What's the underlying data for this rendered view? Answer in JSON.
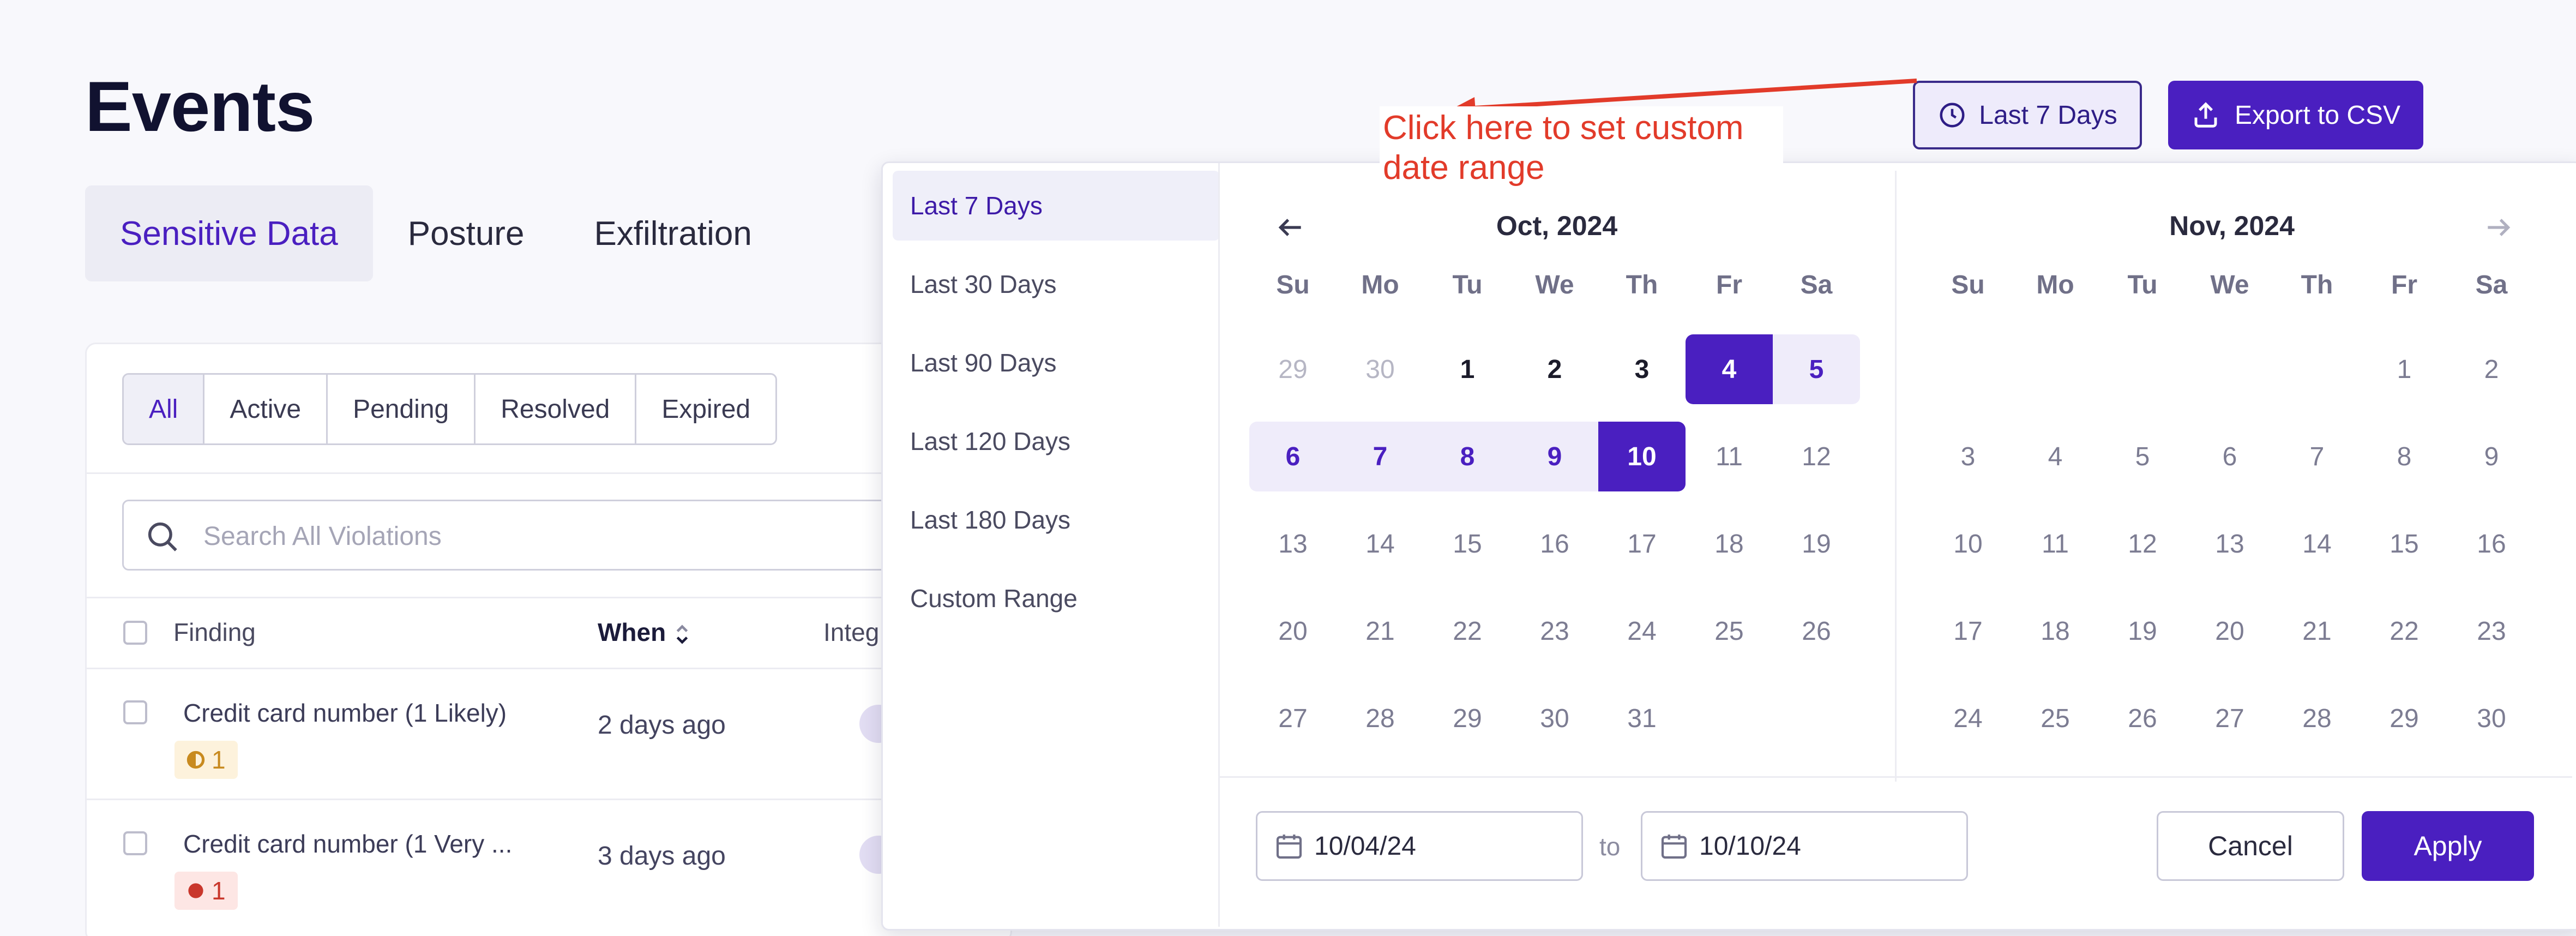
{
  "page": {
    "title": "Events"
  },
  "tabs": [
    {
      "label": "Sensitive Data",
      "active": true
    },
    {
      "label": "Posture",
      "active": false
    },
    {
      "label": "Exfiltration",
      "active": false
    }
  ],
  "filters": [
    "All",
    "Active",
    "Pending",
    "Resolved",
    "Expired"
  ],
  "search": {
    "placeholder": "Search All Violations",
    "icon": "search-icon"
  },
  "table": {
    "columns": {
      "finding": "Finding",
      "when": "When",
      "integration": "Integ"
    },
    "rows": [
      {
        "finding": "Credit card number (1 Likely)",
        "when": "2 days ago",
        "severity": "1",
        "severity_color": "#d9a441"
      },
      {
        "finding": "Credit card number (1 Very ...",
        "when": "3 days ago",
        "severity": "1",
        "severity_color": "#d6453a"
      }
    ]
  },
  "header_buttons": {
    "range_label": "Last 7 Days",
    "export_label": "Export to CSV"
  },
  "annotation": "Click here to set custom date range",
  "datepicker": {
    "presets": [
      "Last 7 Days",
      "Last 30 Days",
      "Last 90 Days",
      "Last 120 Days",
      "Last 180 Days",
      "Custom Range"
    ],
    "selected_preset": "Last 7 Days",
    "weekdays": [
      "Su",
      "Mo",
      "Tu",
      "We",
      "Th",
      "Fr",
      "Sa"
    ],
    "left_month": "Oct, 2024",
    "right_month": "Nov, 2024",
    "left_grid": [
      [
        "29",
        "30",
        "1",
        "2",
        "3",
        "4",
        "5"
      ],
      [
        "6",
        "7",
        "8",
        "9",
        "10",
        "11",
        "12"
      ],
      [
        "13",
        "14",
        "15",
        "16",
        "17",
        "18",
        "19"
      ],
      [
        "20",
        "21",
        "22",
        "23",
        "24",
        "25",
        "26"
      ],
      [
        "27",
        "28",
        "29",
        "30",
        "31",
        "",
        ""
      ]
    ],
    "right_grid": [
      [
        "",
        "",
        "",
        "",
        "",
        "1",
        "2"
      ],
      [
        "3",
        "4",
        "5",
        "6",
        "7",
        "8",
        "9"
      ],
      [
        "10",
        "11",
        "12",
        "13",
        "14",
        "15",
        "16"
      ],
      [
        "17",
        "18",
        "19",
        "20",
        "21",
        "22",
        "23"
      ],
      [
        "24",
        "25",
        "26",
        "27",
        "28",
        "29",
        "30"
      ]
    ],
    "range_start": "10/04/24",
    "range_end": "10/10/24",
    "to_label": "to",
    "cancel_label": "Cancel",
    "apply_label": "Apply"
  },
  "colors": {
    "accent": "#4a1fc0",
    "range_bg": "#efecfa",
    "annotation": "#e23b2a"
  }
}
